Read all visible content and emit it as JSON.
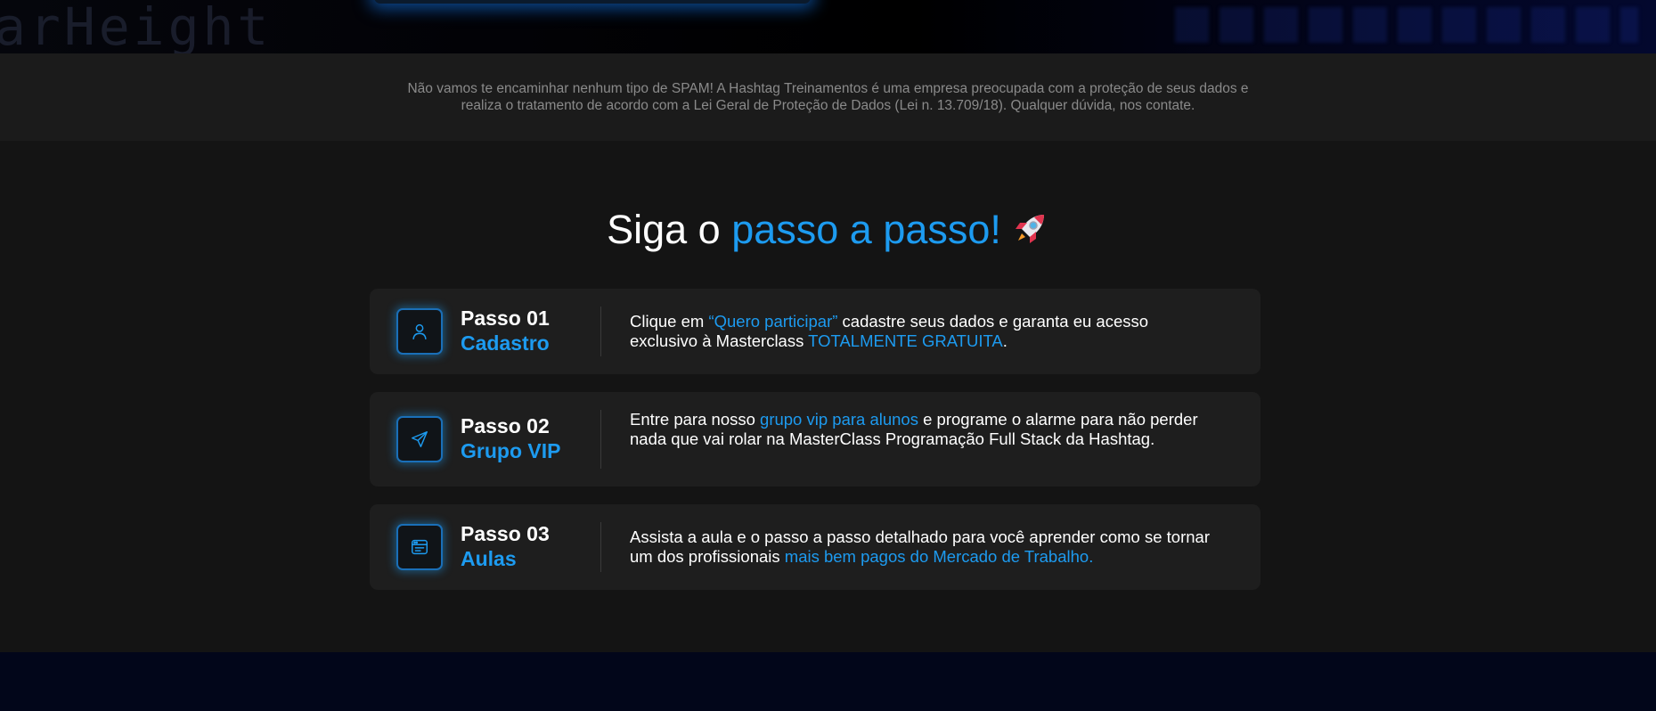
{
  "hero": {
    "code_snippet": "arHeight"
  },
  "notice": {
    "text": "Não vamos te encaminhar nenhum tipo de SPAM! A Hashtag Treinamentos é uma empresa preocupada com a proteção de seus dados e realiza o tratamento de acordo com a Lei Geral de Proteção de Dados (Lei n. 13.709/18). Qualquer dúvida, nos contate."
  },
  "section": {
    "title_prefix": "Siga o ",
    "title_accent": "passo a passo!",
    "title_emoji": "rocket-icon"
  },
  "steps": [
    {
      "number": "Passo 01",
      "name": "Cadastro",
      "icon": "user-icon",
      "text": [
        {
          "t": "Clique em ",
          "hl": false
        },
        {
          "t": "“Quero participar”",
          "hl": true
        },
        {
          "t": " cadastre seus dados e garanta eu acesso exclusivo à Masterclass ",
          "hl": false
        },
        {
          "t": "TOTALMENTE GRATUITA",
          "hl": true
        },
        {
          "t": ".",
          "hl": false
        }
      ]
    },
    {
      "number": "Passo 02",
      "name": "Grupo VIP",
      "icon": "send-icon",
      "text": [
        {
          "t": "Entre para nosso ",
          "hl": false
        },
        {
          "t": "grupo vip para alunos",
          "hl": true
        },
        {
          "t": " e programe o alarme para não perder nada que vai rolar na MasterClass Programação Full Stack da Hashtag.",
          "hl": false
        }
      ]
    },
    {
      "number": "Passo 03",
      "name": "Aulas",
      "icon": "browser-window-icon",
      "text": [
        {
          "t": "Assista a aula e o passo a passo detalhado para você aprender como se tornar um dos profissionais ",
          "hl": false
        },
        {
          "t": "mais bem pagos do Mercado de Trabalho.",
          "hl": true
        }
      ]
    }
  ],
  "colors": {
    "accent": "#1d9bf0",
    "card_bg": "#1e1e1e",
    "page_bg": "#141414"
  }
}
